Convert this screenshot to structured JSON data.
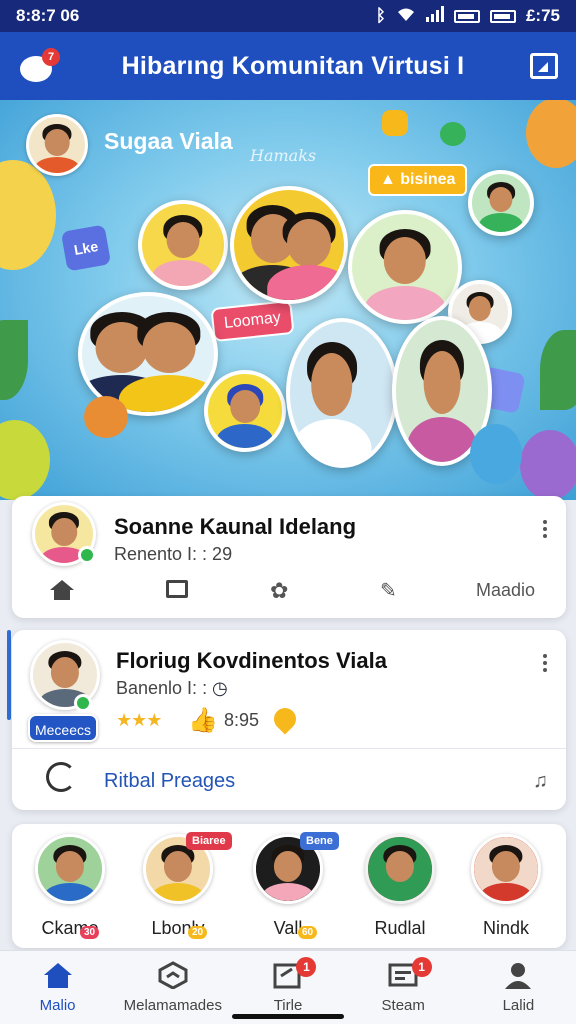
{
  "status_bar": {
    "time": "8:8:7 06",
    "right_time": "£:75"
  },
  "app_bar": {
    "title": "Hibarıng Komunitan Virtusi  I",
    "chat_badge": "7"
  },
  "hero": {
    "label": "Sugaa Viala",
    "script_text": "Hamaks",
    "tag_business": "bisinea",
    "tag_sticker": "Loomay",
    "sticker_like": "Lke"
  },
  "card1": {
    "title": "Soanne Kaunal Idelang",
    "subtitle": "Renento I: : 29",
    "action_last": "Maadio"
  },
  "card2": {
    "title": "Floriug Kovdinentos Viala",
    "subtitle": "Banenlo I: :",
    "join_label": "Meceecs",
    "stars": "★★★",
    "stat": "8:95",
    "link": "Ritbal Preages"
  },
  "stories": [
    {
      "name": "Ckame",
      "tag": "",
      "num": "30"
    },
    {
      "name": "Lbonly",
      "tag": "Biaree",
      "num": "20"
    },
    {
      "name": "Vall",
      "tag": "Bene",
      "num": "60"
    },
    {
      "name": "Rudlal",
      "tag": "",
      "num": ""
    },
    {
      "name": "Nindk",
      "tag": "",
      "num": ""
    }
  ],
  "nav": [
    {
      "label": "Malio",
      "icon": "home-icon",
      "badge": ""
    },
    {
      "label": "Melamamades",
      "icon": "explore-icon",
      "badge": ""
    },
    {
      "label": "Tirle",
      "icon": "tasks-icon",
      "badge": "1"
    },
    {
      "label": "Steam",
      "icon": "stream-icon",
      "badge": "1"
    },
    {
      "label": "Lalid",
      "icon": "profile-icon",
      "badge": ""
    }
  ],
  "colors": {
    "primary": "#1f4fbf",
    "status": "#16297a",
    "accent": "#f6b81b",
    "badge": "#e53935"
  }
}
